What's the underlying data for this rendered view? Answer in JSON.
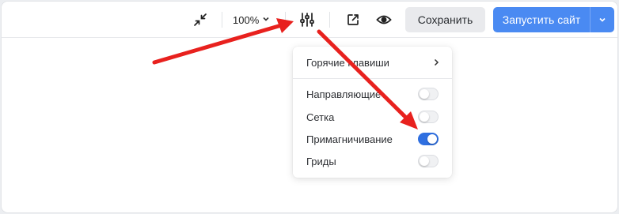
{
  "toolbar": {
    "zoom_value": "100%",
    "save_label": "Сохранить",
    "launch_label": "Запустить сайт"
  },
  "menu": {
    "hotkeys_label": "Горячие клавиши",
    "items": [
      {
        "label": "Направляющие",
        "enabled": false
      },
      {
        "label": "Сетка",
        "enabled": false
      },
      {
        "label": "Примагничивание",
        "enabled": true
      },
      {
        "label": "Гриды",
        "enabled": false
      }
    ]
  },
  "colors": {
    "accent": "#4a8af2",
    "toggle_on": "#2f6fe0",
    "annotation_arrow": "#e8211e"
  },
  "icons": [
    "collapse-icon",
    "chevron-down-icon",
    "settings-sliders-icon",
    "external-link-icon",
    "eye-icon",
    "chevron-right-icon"
  ]
}
